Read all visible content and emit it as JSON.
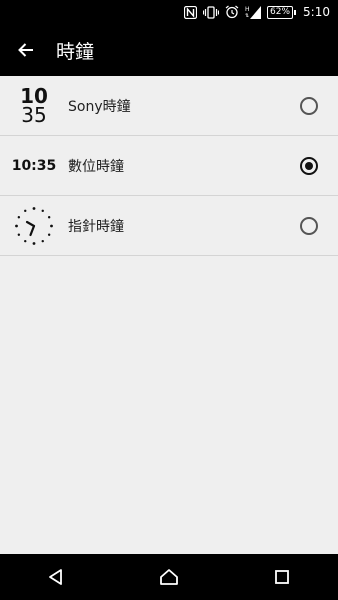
{
  "status_bar": {
    "battery": "62%",
    "time": "5:10",
    "icons": [
      "nfc-icon",
      "vibrate-icon",
      "alarm-icon",
      "signal-icon",
      "battery-icon"
    ]
  },
  "app_bar": {
    "title": "時鐘",
    "back_icon": "arrow-left-icon"
  },
  "options": [
    {
      "label": "Sony時鐘",
      "preview_hour": "10",
      "preview_minute": "35",
      "selected": false
    },
    {
      "label": "數位時鐘",
      "preview_text": "10:35",
      "selected": true
    },
    {
      "label": "指針時鐘",
      "preview": "analog-clock-icon",
      "selected": false
    }
  ],
  "nav_bar": {
    "icons": [
      "back-triangle-icon",
      "home-icon",
      "recents-icon"
    ]
  }
}
